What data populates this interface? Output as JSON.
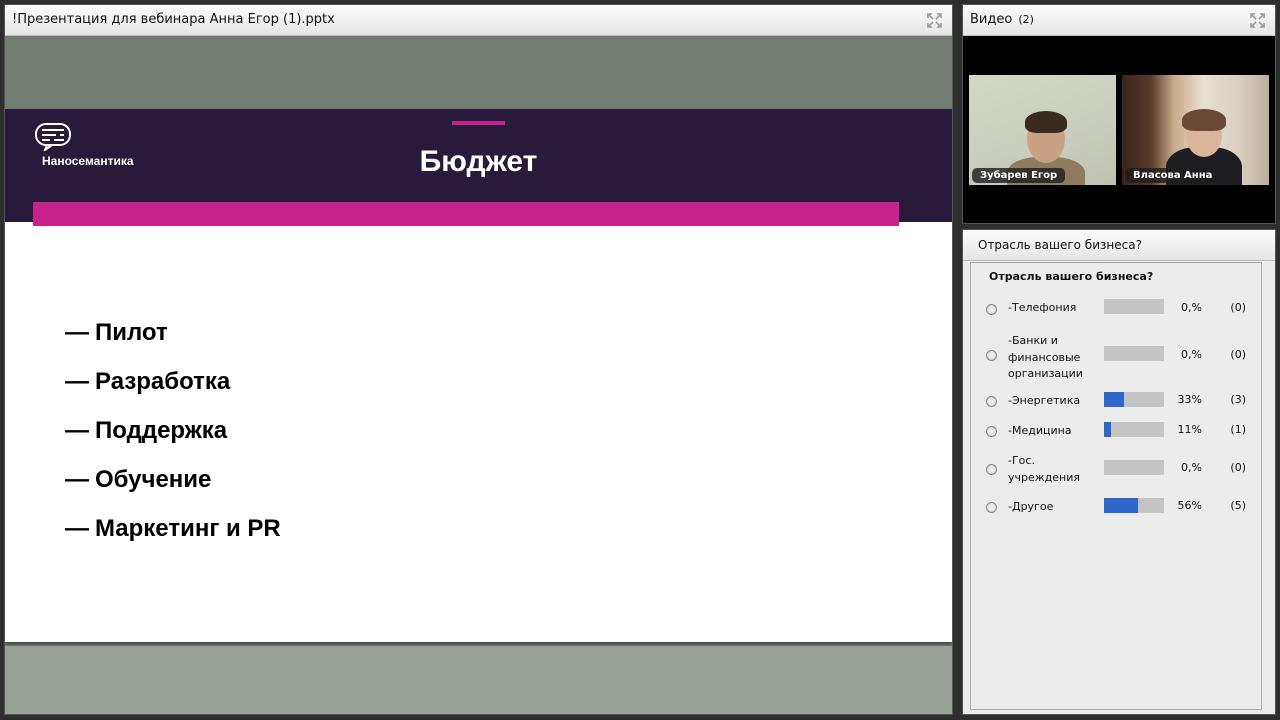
{
  "presentation": {
    "title": "!Презентация для вебинара Анна Егор (1).pptx",
    "slide": {
      "brand": "Наносемантика",
      "title": "Бюджет",
      "bullets": [
        {
          "dash": "—",
          "text": "Пилот"
        },
        {
          "dash": "—",
          "text": "Разработка"
        },
        {
          "dash": "—",
          "text": "Поддержка"
        },
        {
          "dash": "—",
          "text": "Обучение"
        },
        {
          "dash": "—",
          "text": "Маркетинг и PR"
        }
      ]
    }
  },
  "video": {
    "title": "Видео",
    "count": "(2)",
    "participants": [
      {
        "name": "Зубарев Егор"
      },
      {
        "name": "Власова Анна"
      }
    ]
  },
  "poll": {
    "title": "Отрасль вашего бизнеса?",
    "question": "Отрасль вашего бизнеса?",
    "answers": [
      {
        "label": "-Телефония",
        "percent_text": "0,%",
        "count": "(0)",
        "fraction": 0
      },
      {
        "label": "-Банки и финансовые организации",
        "percent_text": "0,%",
        "count": "(0)",
        "fraction": 0
      },
      {
        "label": "-Энергетика",
        "percent_text": "33%",
        "count": "(3)",
        "fraction": 0.33
      },
      {
        "label": "-Медицина",
        "percent_text": "11%",
        "count": "(1)",
        "fraction": 0.11
      },
      {
        "label": "-Гос. учреждения",
        "percent_text": "0,%",
        "count": "(0)",
        "fraction": 0
      },
      {
        "label": "-Другое",
        "percent_text": "56%",
        "count": "(5)",
        "fraction": 0.56
      }
    ]
  },
  "colors": {
    "slide_header": "#271a3a",
    "slide_accent": "#c8238a",
    "poll_bar_fill": "#2e67c9",
    "poll_bar_track": "#c4c4c4"
  },
  "icons": [
    "fullscreen-icon",
    "logo-icon"
  ]
}
